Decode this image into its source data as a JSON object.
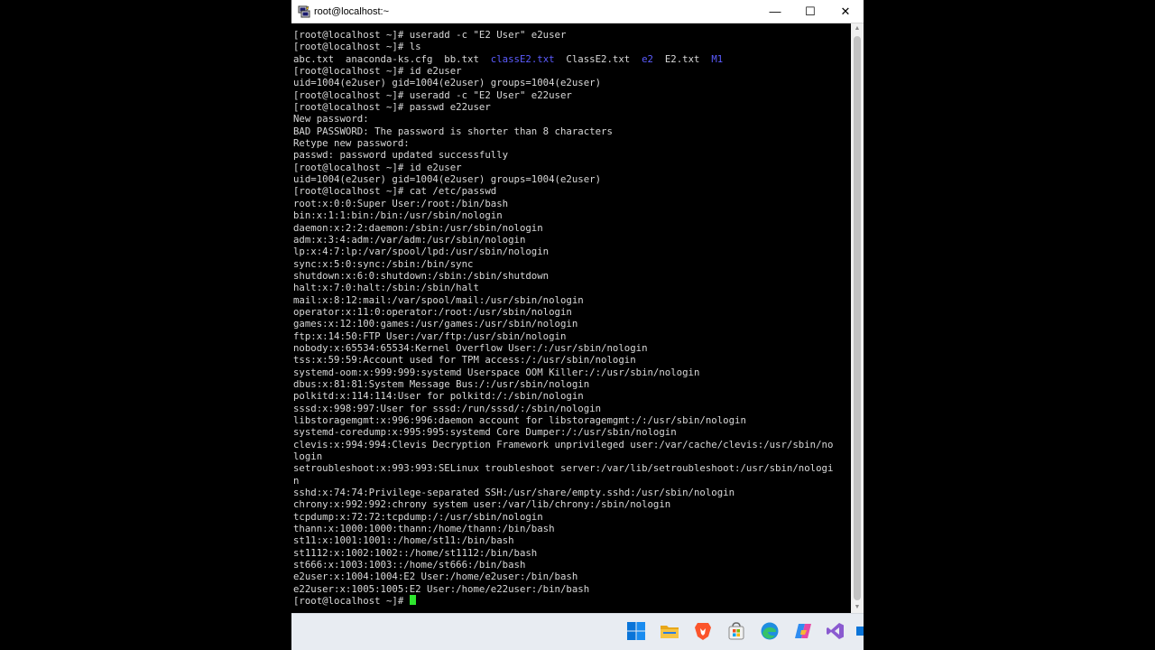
{
  "window": {
    "title": "root@localhost:~",
    "minimize_glyph": "—",
    "maximize_glyph": "☐",
    "close_glyph": "✕"
  },
  "terminal": {
    "lines": [
      {
        "segments": [
          {
            "text": "[root@localhost ~]# useradd -c \"E2 User\" e2user"
          }
        ]
      },
      {
        "segments": [
          {
            "text": "[root@localhost ~]# ls"
          }
        ]
      },
      {
        "segments": [
          {
            "text": "abc.txt  anaconda-ks.cfg  bb.txt  "
          },
          {
            "text": "classE2.txt",
            "kind": "dir"
          },
          {
            "text": "  ClassE2.txt  "
          },
          {
            "text": "e2",
            "kind": "dir"
          },
          {
            "text": "  E2.txt  "
          },
          {
            "text": "M1",
            "kind": "dir"
          }
        ]
      },
      {
        "segments": [
          {
            "text": "[root@localhost ~]# id e2user"
          }
        ]
      },
      {
        "segments": [
          {
            "text": "uid=1004(e2user) gid=1004(e2user) groups=1004(e2user)"
          }
        ]
      },
      {
        "segments": [
          {
            "text": "[root@localhost ~]# useradd -c \"E2 User\" e22user"
          }
        ]
      },
      {
        "segments": [
          {
            "text": "[root@localhost ~]# passwd e22user"
          }
        ]
      },
      {
        "segments": [
          {
            "text": "New password:"
          }
        ]
      },
      {
        "segments": [
          {
            "text": "BAD PASSWORD: The password is shorter than 8 characters"
          }
        ]
      },
      {
        "segments": [
          {
            "text": "Retype new password:"
          }
        ]
      },
      {
        "segments": [
          {
            "text": "passwd: password updated successfully"
          }
        ]
      },
      {
        "segments": [
          {
            "text": "[root@localhost ~]# id e2user"
          }
        ]
      },
      {
        "segments": [
          {
            "text": "uid=1004(e2user) gid=1004(e2user) groups=1004(e2user)"
          }
        ]
      },
      {
        "segments": [
          {
            "text": "[root@localhost ~]# cat /etc/passwd"
          }
        ]
      },
      {
        "segments": [
          {
            "text": "root:x:0:0:Super User:/root:/bin/bash"
          }
        ]
      },
      {
        "segments": [
          {
            "text": "bin:x:1:1:bin:/bin:/usr/sbin/nologin"
          }
        ]
      },
      {
        "segments": [
          {
            "text": "daemon:x:2:2:daemon:/sbin:/usr/sbin/nologin"
          }
        ]
      },
      {
        "segments": [
          {
            "text": "adm:x:3:4:adm:/var/adm:/usr/sbin/nologin"
          }
        ]
      },
      {
        "segments": [
          {
            "text": "lp:x:4:7:lp:/var/spool/lpd:/usr/sbin/nologin"
          }
        ]
      },
      {
        "segments": [
          {
            "text": "sync:x:5:0:sync:/sbin:/bin/sync"
          }
        ]
      },
      {
        "segments": [
          {
            "text": "shutdown:x:6:0:shutdown:/sbin:/sbin/shutdown"
          }
        ]
      },
      {
        "segments": [
          {
            "text": "halt:x:7:0:halt:/sbin:/sbin/halt"
          }
        ]
      },
      {
        "segments": [
          {
            "text": "mail:x:8:12:mail:/var/spool/mail:/usr/sbin/nologin"
          }
        ]
      },
      {
        "segments": [
          {
            "text": "operator:x:11:0:operator:/root:/usr/sbin/nologin"
          }
        ]
      },
      {
        "segments": [
          {
            "text": "games:x:12:100:games:/usr/games:/usr/sbin/nologin"
          }
        ]
      },
      {
        "segments": [
          {
            "text": "ftp:x:14:50:FTP User:/var/ftp:/usr/sbin/nologin"
          }
        ]
      },
      {
        "segments": [
          {
            "text": "nobody:x:65534:65534:Kernel Overflow User:/:/usr/sbin/nologin"
          }
        ]
      },
      {
        "segments": [
          {
            "text": "tss:x:59:59:Account used for TPM access:/:/usr/sbin/nologin"
          }
        ]
      },
      {
        "segments": [
          {
            "text": "systemd-oom:x:999:999:systemd Userspace OOM Killer:/:/usr/sbin/nologin"
          }
        ]
      },
      {
        "segments": [
          {
            "text": "dbus:x:81:81:System Message Bus:/:/usr/sbin/nologin"
          }
        ]
      },
      {
        "segments": [
          {
            "text": "polkitd:x:114:114:User for polkitd:/:/sbin/nologin"
          }
        ]
      },
      {
        "segments": [
          {
            "text": "sssd:x:998:997:User for sssd:/run/sssd/:/sbin/nologin"
          }
        ]
      },
      {
        "segments": [
          {
            "text": "libstoragemgmt:x:996:996:daemon account for libstoragemgmt:/:/usr/sbin/nologin"
          }
        ]
      },
      {
        "segments": [
          {
            "text": "systemd-coredump:x:995:995:systemd Core Dumper:/:/usr/sbin/nologin"
          }
        ]
      },
      {
        "segments": [
          {
            "text": "clevis:x:994:994:Clevis Decryption Framework unprivileged user:/var/cache/clevis:/usr/sbin/no"
          }
        ]
      },
      {
        "segments": [
          {
            "text": "login"
          }
        ]
      },
      {
        "segments": [
          {
            "text": "setroubleshoot:x:993:993:SELinux troubleshoot server:/var/lib/setroubleshoot:/usr/sbin/nologi"
          }
        ]
      },
      {
        "segments": [
          {
            "text": "n"
          }
        ]
      },
      {
        "segments": [
          {
            "text": "sshd:x:74:74:Privilege-separated SSH:/usr/share/empty.sshd:/usr/sbin/nologin"
          }
        ]
      },
      {
        "segments": [
          {
            "text": "chrony:x:992:992:chrony system user:/var/lib/chrony:/sbin/nologin"
          }
        ]
      },
      {
        "segments": [
          {
            "text": "tcpdump:x:72:72:tcpdump:/:/usr/sbin/nologin"
          }
        ]
      },
      {
        "segments": [
          {
            "text": "thann:x:1000:1000:thann:/home/thann:/bin/bash"
          }
        ]
      },
      {
        "segments": [
          {
            "text": "st11:x:1001:1001::/home/st11:/bin/bash"
          }
        ]
      },
      {
        "segments": [
          {
            "text": "st1112:x:1002:1002::/home/st1112:/bin/bash"
          }
        ]
      },
      {
        "segments": [
          {
            "text": "st666:x:1003:1003::/home/st666:/bin/bash"
          }
        ]
      },
      {
        "segments": [
          {
            "text": "e2user:x:1004:1004:E2 User:/home/e2user:/bin/bash"
          }
        ]
      },
      {
        "segments": [
          {
            "text": "e22user:x:1005:1005:E2 User:/home/e22user:/bin/bash"
          }
        ]
      },
      {
        "segments": [
          {
            "text": "[root@localhost ~]# "
          }
        ],
        "cursor": true
      }
    ]
  },
  "colors": {
    "terminal_bg": "#000000",
    "terminal_fg": "#d8d8d8",
    "directory": "#5c5cff",
    "cursor": "#2ee62e",
    "taskbar_bg": "#e8ecf2"
  },
  "taskbar": {
    "icons": [
      {
        "name": "windows-start-icon"
      },
      {
        "name": "file-explorer-icon"
      },
      {
        "name": "brave-browser-icon"
      },
      {
        "name": "microsoft-store-icon"
      },
      {
        "name": "edge-browser-icon"
      },
      {
        "name": "copilot-icon"
      },
      {
        "name": "visual-studio-icon"
      },
      {
        "name": "overflow-app-icon"
      }
    ]
  }
}
